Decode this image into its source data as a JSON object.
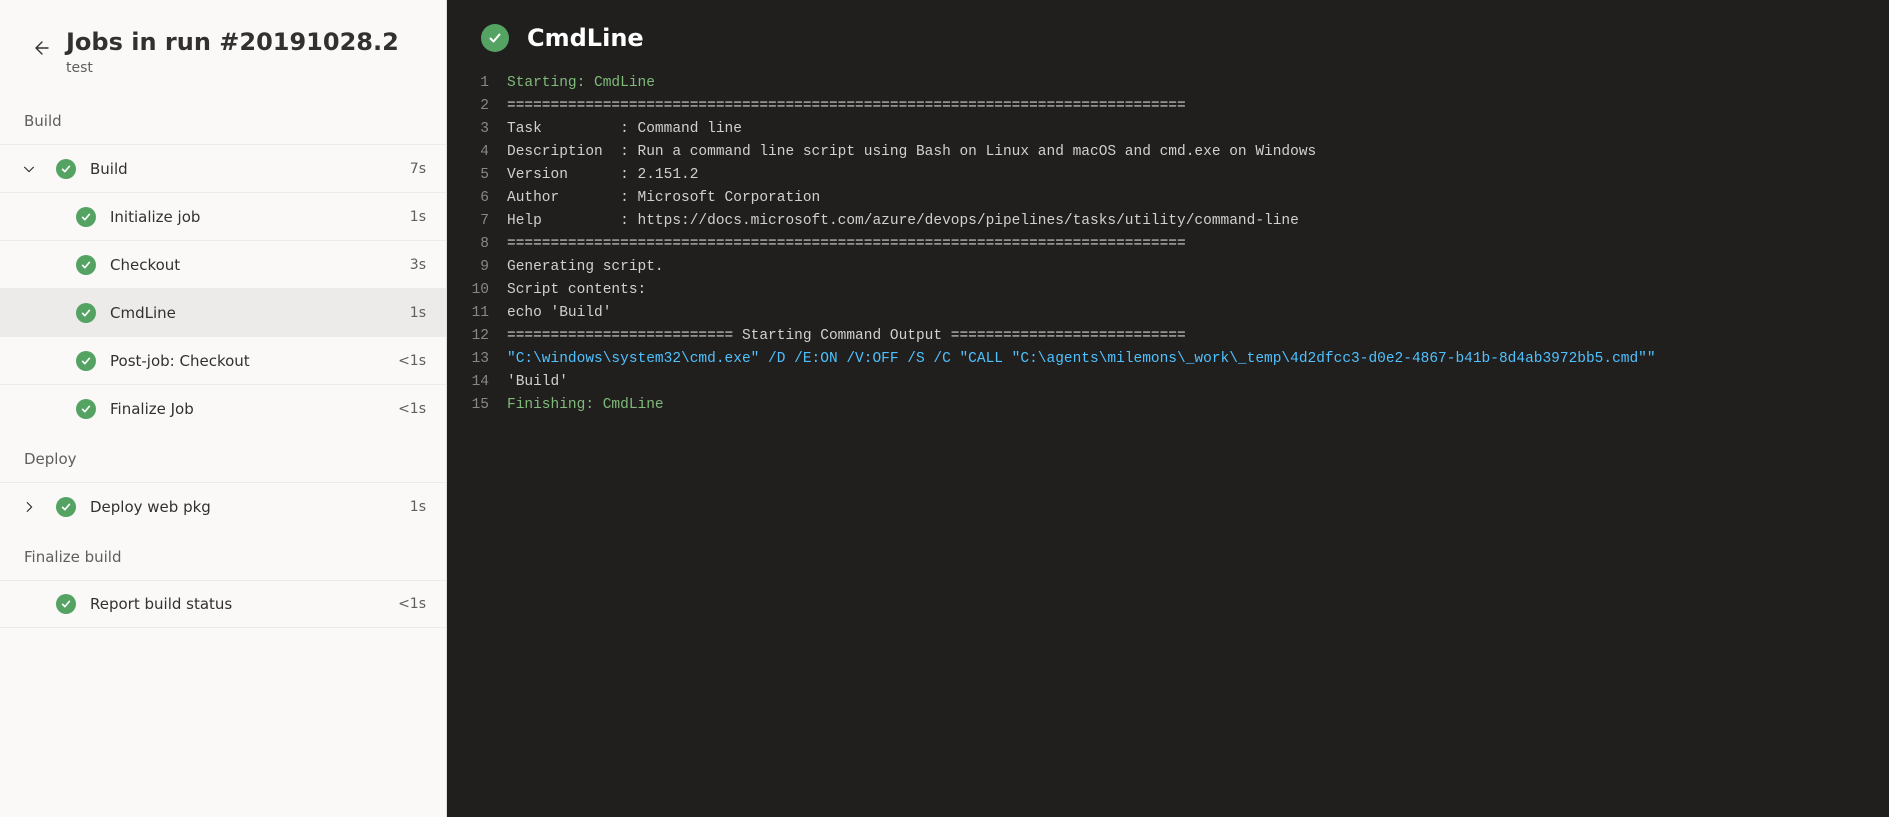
{
  "header": {
    "title": "Jobs in run #20191028.2",
    "subtitle": "test"
  },
  "stages": [
    {
      "name": "Build",
      "jobs": [
        {
          "label": "Build",
          "time": "7s",
          "expandable": true,
          "expanded": true,
          "steps": [
            {
              "label": "Initialize job",
              "time": "1s",
              "selected": false
            },
            {
              "label": "Checkout",
              "time": "3s",
              "selected": false
            },
            {
              "label": "CmdLine",
              "time": "1s",
              "selected": true
            },
            {
              "label": "Post-job: Checkout",
              "time": "<1s",
              "selected": false
            },
            {
              "label": "Finalize Job",
              "time": "<1s",
              "selected": false
            }
          ]
        }
      ]
    },
    {
      "name": "Deploy",
      "jobs": [
        {
          "label": "Deploy web pkg",
          "time": "1s",
          "expandable": true,
          "expanded": false,
          "steps": []
        }
      ]
    },
    {
      "name": "Finalize build",
      "jobs": [
        {
          "label": "Report build status",
          "time": "<1s",
          "expandable": false,
          "expanded": false,
          "steps": []
        }
      ]
    }
  ],
  "main": {
    "title": "CmdLine",
    "log": [
      {
        "n": 1,
        "cls": "c-green",
        "text": "Starting: CmdLine"
      },
      {
        "n": 2,
        "cls": "c-plain",
        "text": "=============================================================================="
      },
      {
        "n": 3,
        "cls": "c-plain",
        "text": "Task         : Command line"
      },
      {
        "n": 4,
        "cls": "c-plain",
        "text": "Description  : Run a command line script using Bash on Linux and macOS and cmd.exe on Windows"
      },
      {
        "n": 5,
        "cls": "c-plain",
        "text": "Version      : 2.151.2"
      },
      {
        "n": 6,
        "cls": "c-plain",
        "text": "Author       : Microsoft Corporation"
      },
      {
        "n": 7,
        "cls": "c-plain",
        "text": "Help         : https://docs.microsoft.com/azure/devops/pipelines/tasks/utility/command-line"
      },
      {
        "n": 8,
        "cls": "c-plain",
        "text": "=============================================================================="
      },
      {
        "n": 9,
        "cls": "c-plain",
        "text": "Generating script."
      },
      {
        "n": 10,
        "cls": "c-plain",
        "text": "Script contents:"
      },
      {
        "n": 11,
        "cls": "c-plain",
        "text": "echo 'Build'"
      },
      {
        "n": 12,
        "cls": "c-plain",
        "text": "========================== Starting Command Output ==========================="
      },
      {
        "n": 13,
        "cls": "c-cyan",
        "text": "\"C:\\windows\\system32\\cmd.exe\" /D /E:ON /V:OFF /S /C \"CALL \"C:\\agents\\milemons\\_work\\_temp\\4d2dfcc3-d0e2-4867-b41b-8d4ab3972bb5.cmd\"\""
      },
      {
        "n": 14,
        "cls": "c-plain",
        "text": "'Build'"
      },
      {
        "n": 15,
        "cls": "c-green",
        "text": "Finishing: CmdLine"
      }
    ]
  }
}
